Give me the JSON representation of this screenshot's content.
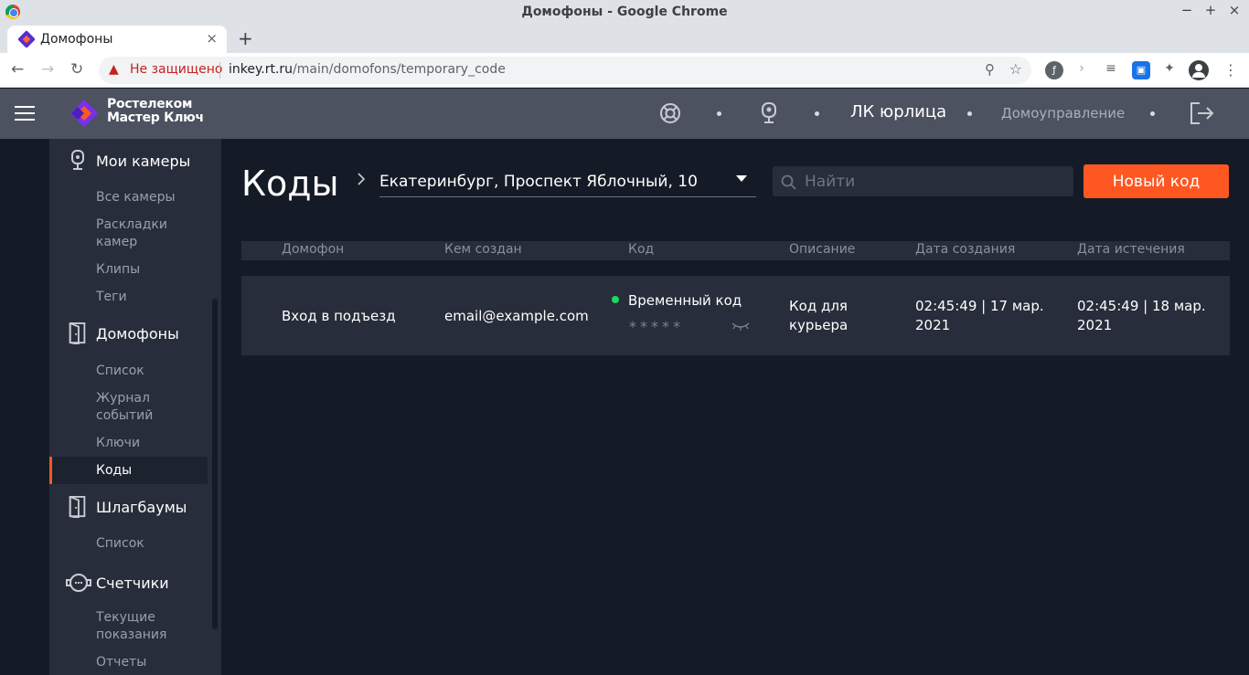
{
  "browser": {
    "window_title": "Домофоны - Google Chrome",
    "tab_title": "Домофоны",
    "security_label": "Не защищено",
    "url_host": "inkey.rt.ru",
    "url_path": "/main/domofons/temporary_code"
  },
  "header": {
    "logo_line1": "Ростелеком",
    "logo_line2": "Мастер Ключ",
    "account": "ЛК юрлица",
    "management": "Домоуправление"
  },
  "sidebar": {
    "cameras": {
      "title": "Мои камеры",
      "items": [
        "Все камеры",
        "Раскладки камер",
        "Клипы",
        "Теги"
      ]
    },
    "intercoms": {
      "title": "Домофоны",
      "items": [
        "Список",
        "Журнал событий",
        "Ключи",
        "Коды"
      ],
      "active": "Коды"
    },
    "barriers": {
      "title": "Шлагбаумы",
      "items": [
        "Список"
      ]
    },
    "meters": {
      "title": "Счетчики",
      "items": [
        "Текущие показания",
        "Отчеты"
      ]
    }
  },
  "page": {
    "title": "Коды",
    "address": "Екатеринбург, Проспект Яблочный, 10",
    "search_placeholder": "Найти",
    "new_button": "Новый код"
  },
  "table": {
    "columns": [
      "Домофон",
      "Кем создан",
      "Код",
      "Описание",
      "Дата создания",
      "Дата истечения"
    ],
    "rows": [
      {
        "intercom": "Вход в подъезд",
        "created_by": "email@example.com",
        "code_type": "Временный код",
        "code_masked": "*****",
        "description": "Код для курьера",
        "created_at": "02:45:49 | 17 мар. 2021",
        "expires_at": "02:45:49 | 18 мар. 2021",
        "status_color": "#1ed760"
      }
    ]
  },
  "colors": {
    "accent": "#ff5722",
    "background": "#151b26",
    "panel": "#272d3a",
    "header": "#4c5260"
  }
}
